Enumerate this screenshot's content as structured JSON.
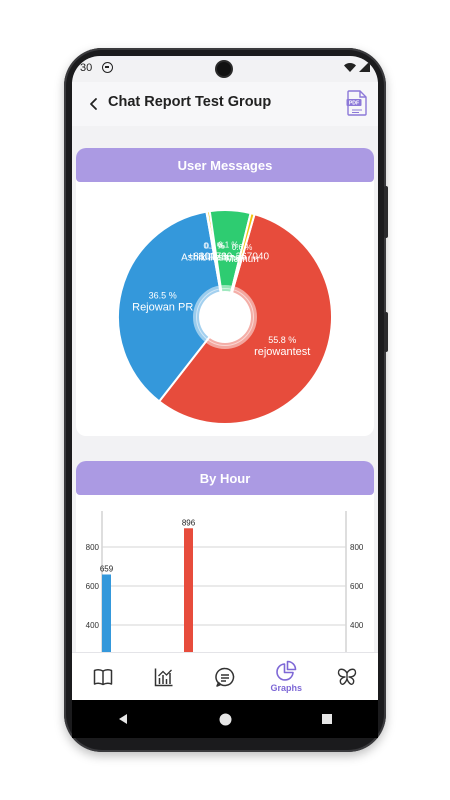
{
  "status_bar": {
    "time": "30"
  },
  "header": {
    "title": "Chat Report Test Group"
  },
  "user_messages": {
    "title": "User Messages"
  },
  "by_hour": {
    "title": "By Hour"
  },
  "nav": {
    "items": [
      {
        "id": "book",
        "label": ""
      },
      {
        "id": "stats",
        "label": ""
      },
      {
        "id": "chat",
        "label": ""
      },
      {
        "id": "graphs",
        "label": "Graphs",
        "active": true
      },
      {
        "id": "butterfly",
        "label": ""
      }
    ]
  },
  "colors": {
    "accent": "#ab9ae3",
    "active_nav": "#7e68d6",
    "red": "#e74c3c",
    "blue": "#3498db",
    "green": "#2ecc71",
    "yellow": "#f1c40f"
  },
  "chart_data": [
    {
      "type": "pie",
      "title": "User Messages",
      "hole": true,
      "slices": [
        {
          "label": "rejowantest",
          "percent": "55.8 %",
          "value": 55.8,
          "color": "#e74c3c"
        },
        {
          "label": "Rejowan PR",
          "percent": "36.5 %",
          "value": 36.5,
          "color": "#3498db"
        },
        {
          "label": "Ashik Rahman",
          "percent": "0.1 %",
          "value": 0.1,
          "color": "#f5f5f5"
        },
        {
          "label": "Ullash",
          "percent": "0.4 %",
          "value": 0.4,
          "color": "#f1c40f"
        },
        {
          "label": "+8801739-267040",
          "percent": "6.1 %",
          "value": 6.1,
          "color": "#2ecc71"
        },
        {
          "label": "Mamun",
          "percent": "0.6 %",
          "value": 0.6,
          "color": "#f1c40f"
        }
      ]
    },
    {
      "type": "bar",
      "title": "By Hour",
      "bars": [
        {
          "value": 659,
          "label": "659",
          "color": "#3498db"
        },
        {
          "value": 896,
          "label": "896",
          "color": "#e74c3c"
        }
      ],
      "y_ticks": [
        "800",
        "600",
        "400"
      ],
      "y_tick_values": [
        800,
        600,
        400
      ],
      "grid": true
    }
  ]
}
